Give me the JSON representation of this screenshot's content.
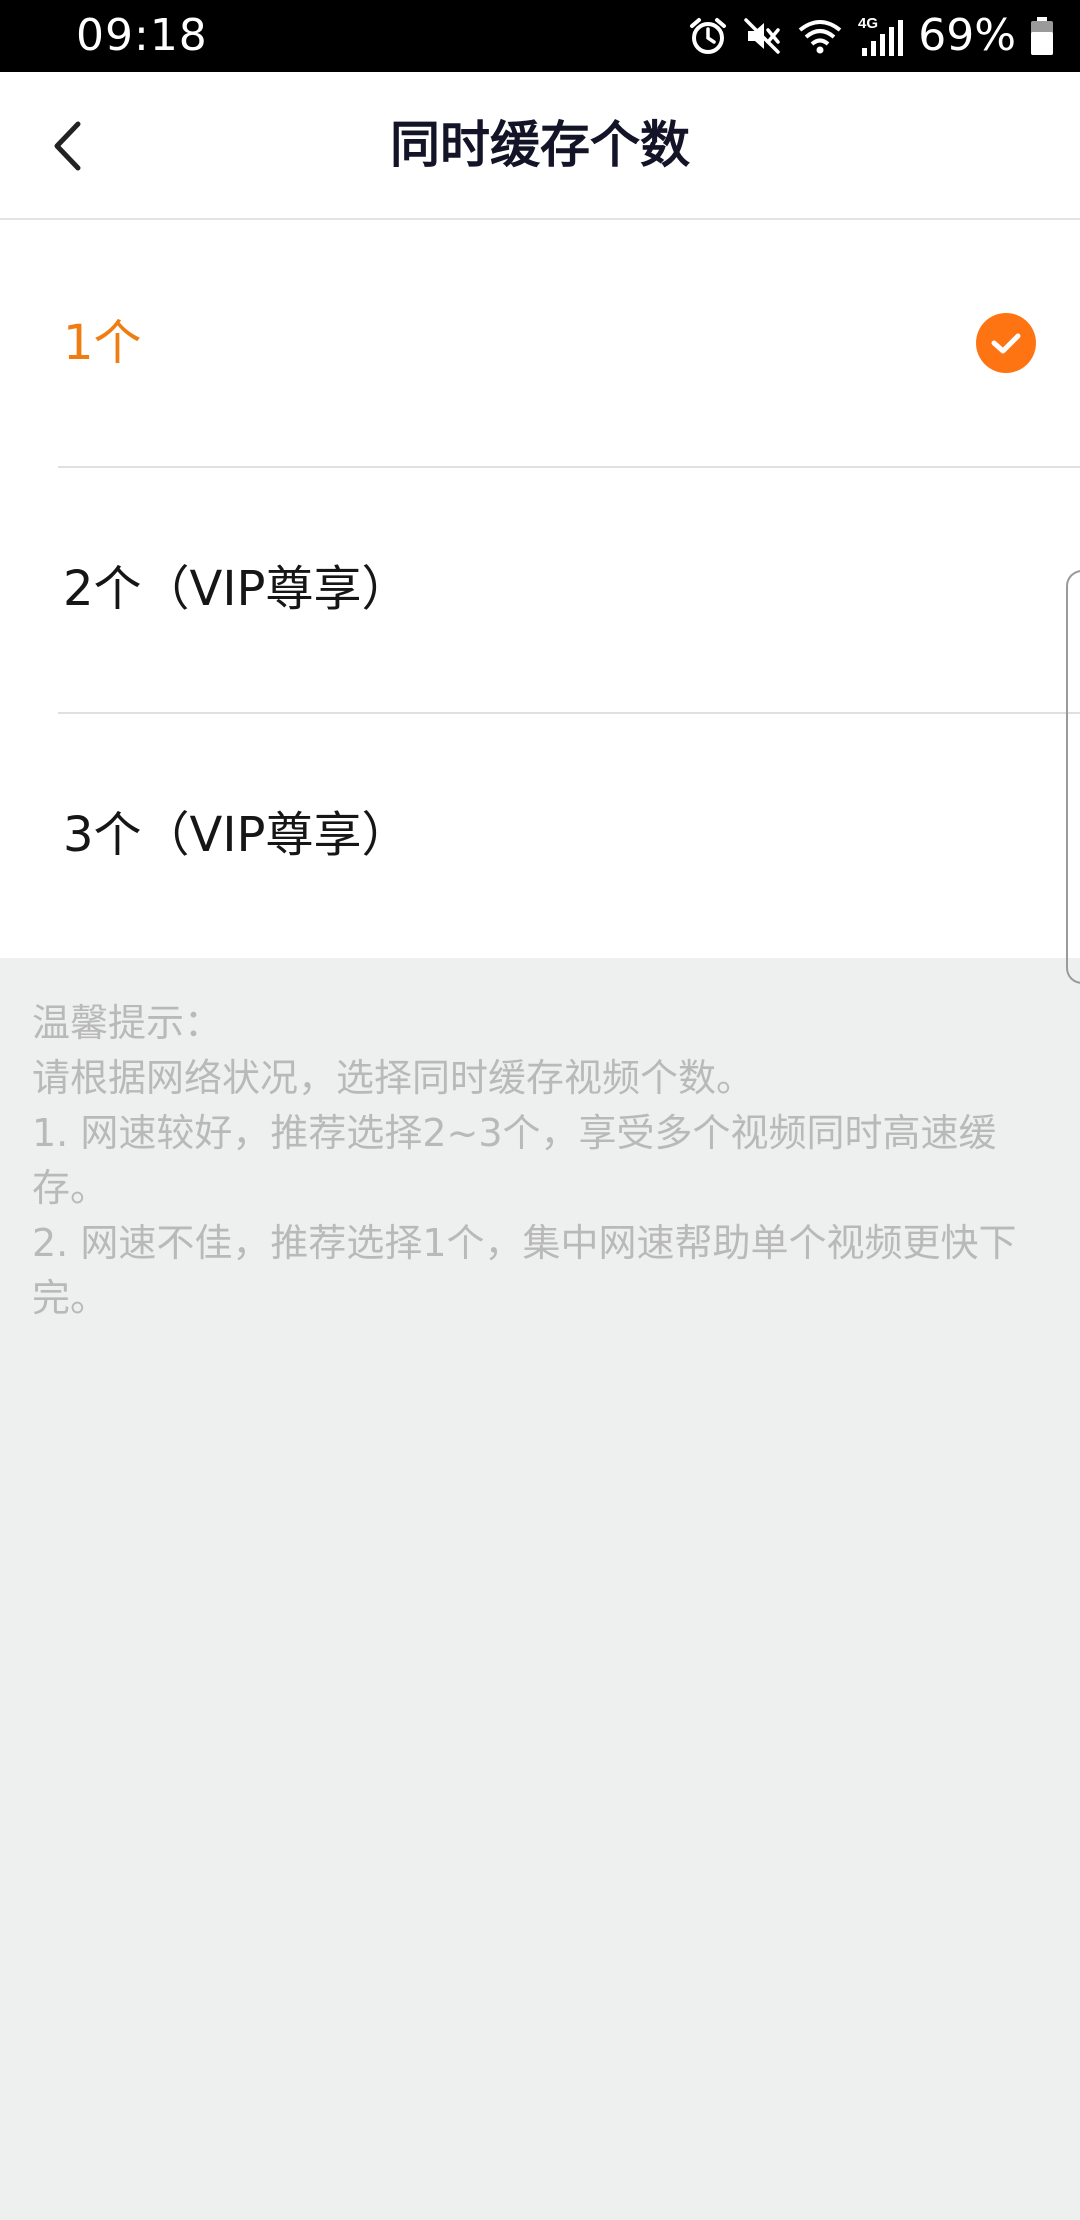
{
  "status_bar": {
    "time": "09:18",
    "battery": "69%",
    "network": "4G",
    "icons": [
      "alarm-icon",
      "mute-icon",
      "wifi-icon",
      "signal-icon",
      "battery-icon"
    ]
  },
  "header": {
    "title": "同时缓存个数",
    "back_icon": "chevron-left-icon"
  },
  "options": [
    {
      "label": "1个",
      "selected": true
    },
    {
      "label": "2个（VIP尊享）",
      "selected": false
    },
    {
      "label": "3个（VIP尊享）",
      "selected": false
    }
  ],
  "tips": {
    "heading": "温馨提示：",
    "lines": [
      "请根据网络状况，选择同时缓存视频个数。",
      "1. 网速较好，推荐选择2~3个，享受多个视频同时高速缓存。",
      "2. 网速不佳，推荐选择1个，集中网速帮助单个视频更快下完。"
    ]
  },
  "colors": {
    "accent": "#f07d12",
    "background": "#eef0ef",
    "tip_text": "#b9b9b9",
    "title_text": "#141428"
  }
}
